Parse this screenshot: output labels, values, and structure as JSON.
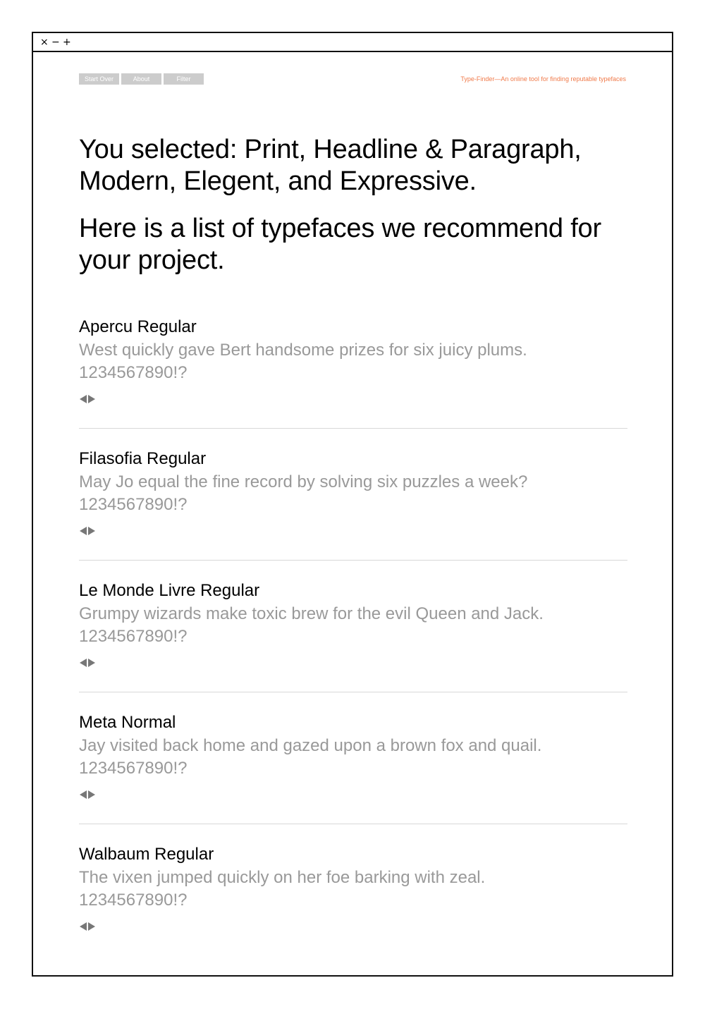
{
  "window": {
    "controls": [
      "×",
      "−",
      "+"
    ]
  },
  "nav": {
    "buttons": [
      "Start Over",
      "About",
      "Filter"
    ],
    "tagline": "Type-Finder—An online tool for finding reputable typefaces"
  },
  "selection": {
    "summary": "You selected: Print, Headline & Paragraph, Modern, Elegent, and Expressive.",
    "recommendation": "Here is a list of typefaces we recommend for your project."
  },
  "typefaces": [
    {
      "name": "Apercu Regular",
      "sample": "West quickly gave Bert handsome prizes for six juicy plums.",
      "numerals": "1234567890!?"
    },
    {
      "name": "Filasofia Regular",
      "sample": "May Jo equal the fine record by solving six puzzles a week?",
      "numerals": "1234567890!?"
    },
    {
      "name": "Le Monde Livre Regular",
      "sample": "Grumpy wizards make toxic brew for the evil Queen and Jack.",
      "numerals": "1234567890!?"
    },
    {
      "name": "Meta Normal",
      "sample": "Jay visited back home and gazed upon a brown fox and quail.",
      "numerals": "1234567890!?"
    },
    {
      "name": "Walbaum Regular",
      "sample": "The vixen jumped quickly on her foe barking with zeal.",
      "numerals": "1234567890!?"
    }
  ],
  "colors": {
    "accent": "#f07a4a",
    "nav_button_bg": "#cccccc",
    "sample_text": "#999999",
    "divider": "#d8d8d8"
  },
  "icons": {
    "prev": "triangle-left-icon",
    "next": "triangle-right-icon"
  }
}
